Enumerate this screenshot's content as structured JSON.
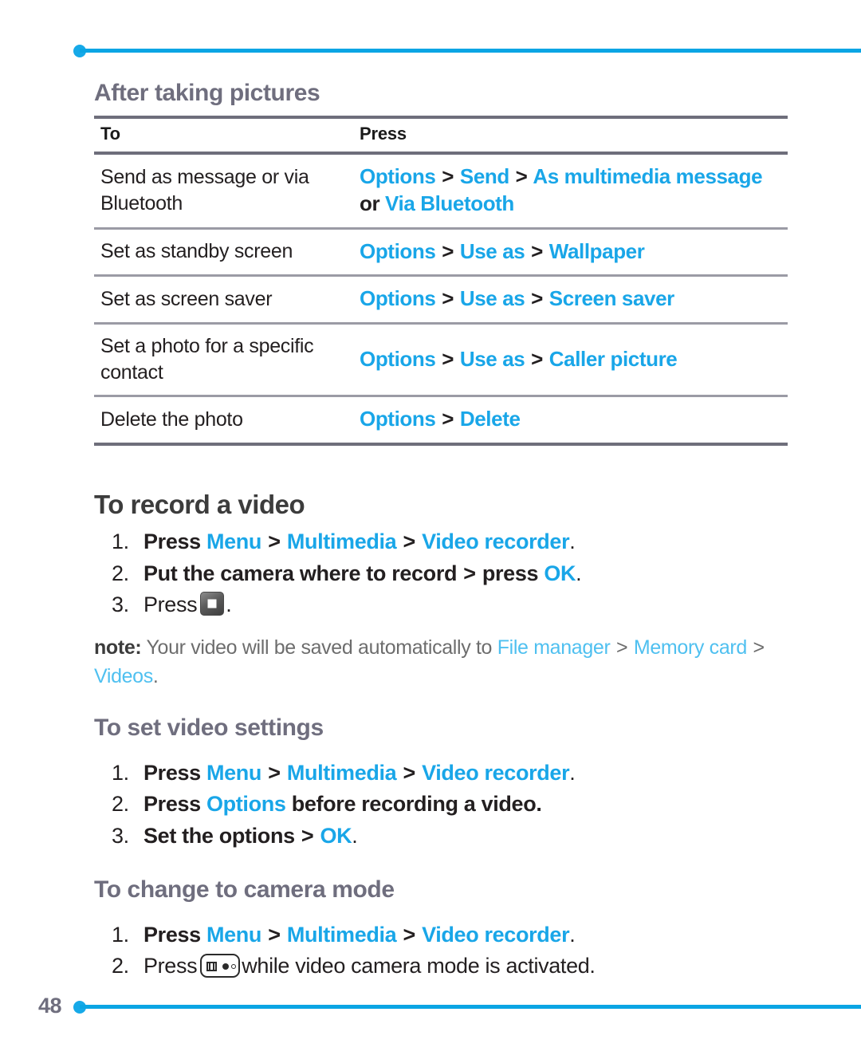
{
  "page": {
    "number": "48",
    "accent_color": "#19a6e8",
    "heading_color": "#6f6e7e",
    "body_color": "#231f20",
    "rule_color": "#0aa5e4"
  },
  "table_section": {
    "heading": "After taking pictures",
    "columns": [
      "To",
      "Press"
    ],
    "rows": [
      {
        "to": "Send as message or via Bluetooth",
        "press_tokens": [
          {
            "text": "Options",
            "style": "menu"
          },
          {
            "text": ">",
            "style": "sep"
          },
          {
            "text": "Send",
            "style": "menu"
          },
          {
            "text": ">",
            "style": "sep"
          },
          {
            "text": "As multimedia message",
            "style": "menu"
          },
          {
            "text": "or",
            "style": "plain"
          },
          {
            "text": "Via Bluetooth",
            "style": "menu"
          }
        ]
      },
      {
        "to": "Set as standby screen",
        "press_tokens": [
          {
            "text": "Options",
            "style": "menu"
          },
          {
            "text": ">",
            "style": "sep"
          },
          {
            "text": "Use as",
            "style": "menu"
          },
          {
            "text": ">",
            "style": "sep"
          },
          {
            "text": "Wallpaper",
            "style": "menu"
          }
        ]
      },
      {
        "to": "Set as screen saver",
        "press_tokens": [
          {
            "text": "Options",
            "style": "menu"
          },
          {
            "text": ">",
            "style": "sep"
          },
          {
            "text": "Use as",
            "style": "menu"
          },
          {
            "text": ">",
            "style": "sep"
          },
          {
            "text": "Screen saver",
            "style": "menu"
          }
        ]
      },
      {
        "to": "Set a photo for a specific contact",
        "press_tokens": [
          {
            "text": "Options",
            "style": "menu"
          },
          {
            "text": ">",
            "style": "sep"
          },
          {
            "text": "Use as",
            "style": "menu"
          },
          {
            "text": ">",
            "style": "sep"
          },
          {
            "text": "Caller picture",
            "style": "menu"
          }
        ]
      },
      {
        "to": "Delete the photo",
        "press_tokens": [
          {
            "text": "Options",
            "style": "menu"
          },
          {
            "text": ">",
            "style": "sep"
          },
          {
            "text": "Delete",
            "style": "menu"
          }
        ]
      }
    ]
  },
  "record_video": {
    "heading": "To record a video",
    "steps": [
      {
        "num": "1.",
        "tokens": [
          {
            "text": "Press",
            "style": "plain"
          },
          {
            "text": "Menu",
            "style": "menu"
          },
          {
            "text": ">",
            "style": "sep"
          },
          {
            "text": "Multimedia",
            "style": "menu"
          },
          {
            "text": ">",
            "style": "sep"
          },
          {
            "text": "Video recorder",
            "style": "menu"
          },
          {
            "text": ".",
            "style": "plain-tight"
          }
        ]
      },
      {
        "num": "2.",
        "tokens": [
          {
            "text": "Put the camera where to record",
            "style": "plain"
          },
          {
            "text": ">",
            "style": "sep"
          },
          {
            "text": "press",
            "style": "plain"
          },
          {
            "text": "OK",
            "style": "menu"
          },
          {
            "text": ".",
            "style": "plain-tight"
          }
        ]
      },
      {
        "num": "3.",
        "prefix": "Press",
        "icon": "record-key-icon",
        "suffix": "."
      }
    ],
    "note": {
      "label": "note:",
      "text_before": "Your video will be saved automatically to",
      "path_tokens": [
        {
          "text": "File manager",
          "style": "menu"
        },
        {
          "text": ">",
          "style": "sep"
        },
        {
          "text": "Memory card",
          "style": "menu"
        },
        {
          "text": ">",
          "style": "sep"
        },
        {
          "text": "Videos",
          "style": "menu"
        }
      ],
      "trailing": "."
    }
  },
  "video_settings": {
    "heading": "To set video settings",
    "steps": [
      {
        "num": "1.",
        "tokens": [
          {
            "text": "Press",
            "style": "plain"
          },
          {
            "text": "Menu",
            "style": "menu"
          },
          {
            "text": ">",
            "style": "sep"
          },
          {
            "text": "Multimedia",
            "style": "menu"
          },
          {
            "text": ">",
            "style": "sep"
          },
          {
            "text": "Video recorder",
            "style": "menu"
          },
          {
            "text": ".",
            "style": "plain-tight"
          }
        ]
      },
      {
        "num": "2.",
        "tokens": [
          {
            "text": "Press",
            "style": "plain"
          },
          {
            "text": "Options",
            "style": "menu"
          },
          {
            "text": "before recording a video.",
            "style": "plain"
          }
        ]
      },
      {
        "num": "3.",
        "tokens": [
          {
            "text": "Set the options",
            "style": "plain"
          },
          {
            "text": ">",
            "style": "sep"
          },
          {
            "text": "OK",
            "style": "menu"
          },
          {
            "text": ".",
            "style": "plain-tight"
          }
        ]
      }
    ]
  },
  "camera_mode": {
    "heading": "To change to camera mode",
    "steps": [
      {
        "num": "1.",
        "tokens": [
          {
            "text": "Press",
            "style": "plain"
          },
          {
            "text": "Menu",
            "style": "menu"
          },
          {
            "text": ">",
            "style": "sep"
          },
          {
            "text": "Multimedia",
            "style": "menu"
          },
          {
            "text": ">",
            "style": "sep"
          },
          {
            "text": "Video recorder",
            "style": "menu"
          },
          {
            "text": ".",
            "style": "plain-tight"
          }
        ]
      },
      {
        "num": "2.",
        "prefix": "Press",
        "icon": "camera-mode-key-icon",
        "suffix": "while video camera mode is activated."
      }
    ]
  }
}
